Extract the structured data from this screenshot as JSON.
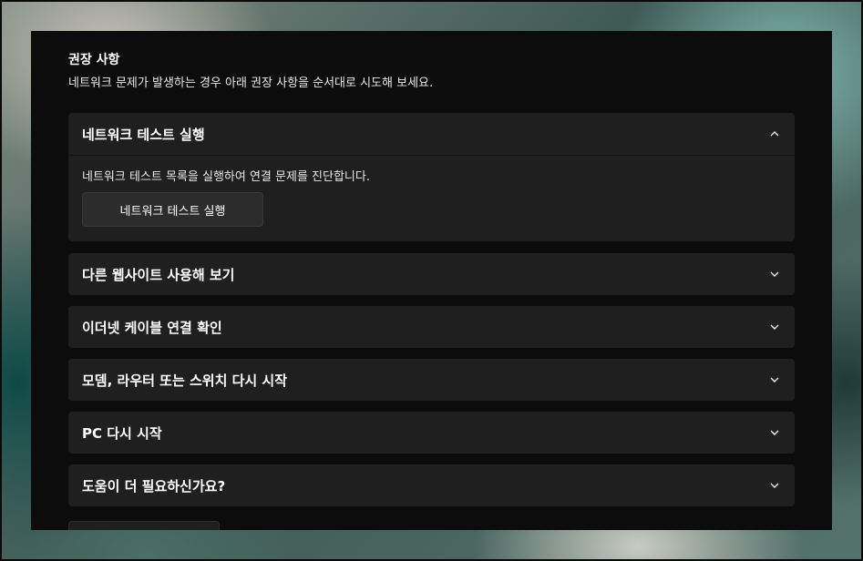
{
  "section": {
    "title": "권장 사항",
    "description": "네트워크 문제가 발생하는 경우 아래 권장 사항을 순서대로 시도해 보세요."
  },
  "accordion": [
    {
      "title": "네트워크 테스트 실행",
      "expanded": true,
      "body_text": "네트워크 테스트 목록을 실행하여 연결 문제를 진단합니다.",
      "button_label": "네트워크 테스트 실행"
    },
    {
      "title": "다른 웹사이트 사용해 보기",
      "expanded": false
    },
    {
      "title": "이더넷 케이블 연결 확인",
      "expanded": false
    },
    {
      "title": "모뎀, 라우터 또는 스위치 다시 시작",
      "expanded": false
    },
    {
      "title": "PC 다시 시작",
      "expanded": false
    },
    {
      "title": "도움이 더 필요하신가요?",
      "expanded": false
    }
  ],
  "icons": {
    "expanded": "chevron-up-icon",
    "collapsed": "chevron-down-icon"
  },
  "colors": {
    "panel_bg": "#0c0c0c",
    "card_bg": "#1f1f1f",
    "button_bg": "#2c2c2c",
    "text": "#ffffff"
  }
}
